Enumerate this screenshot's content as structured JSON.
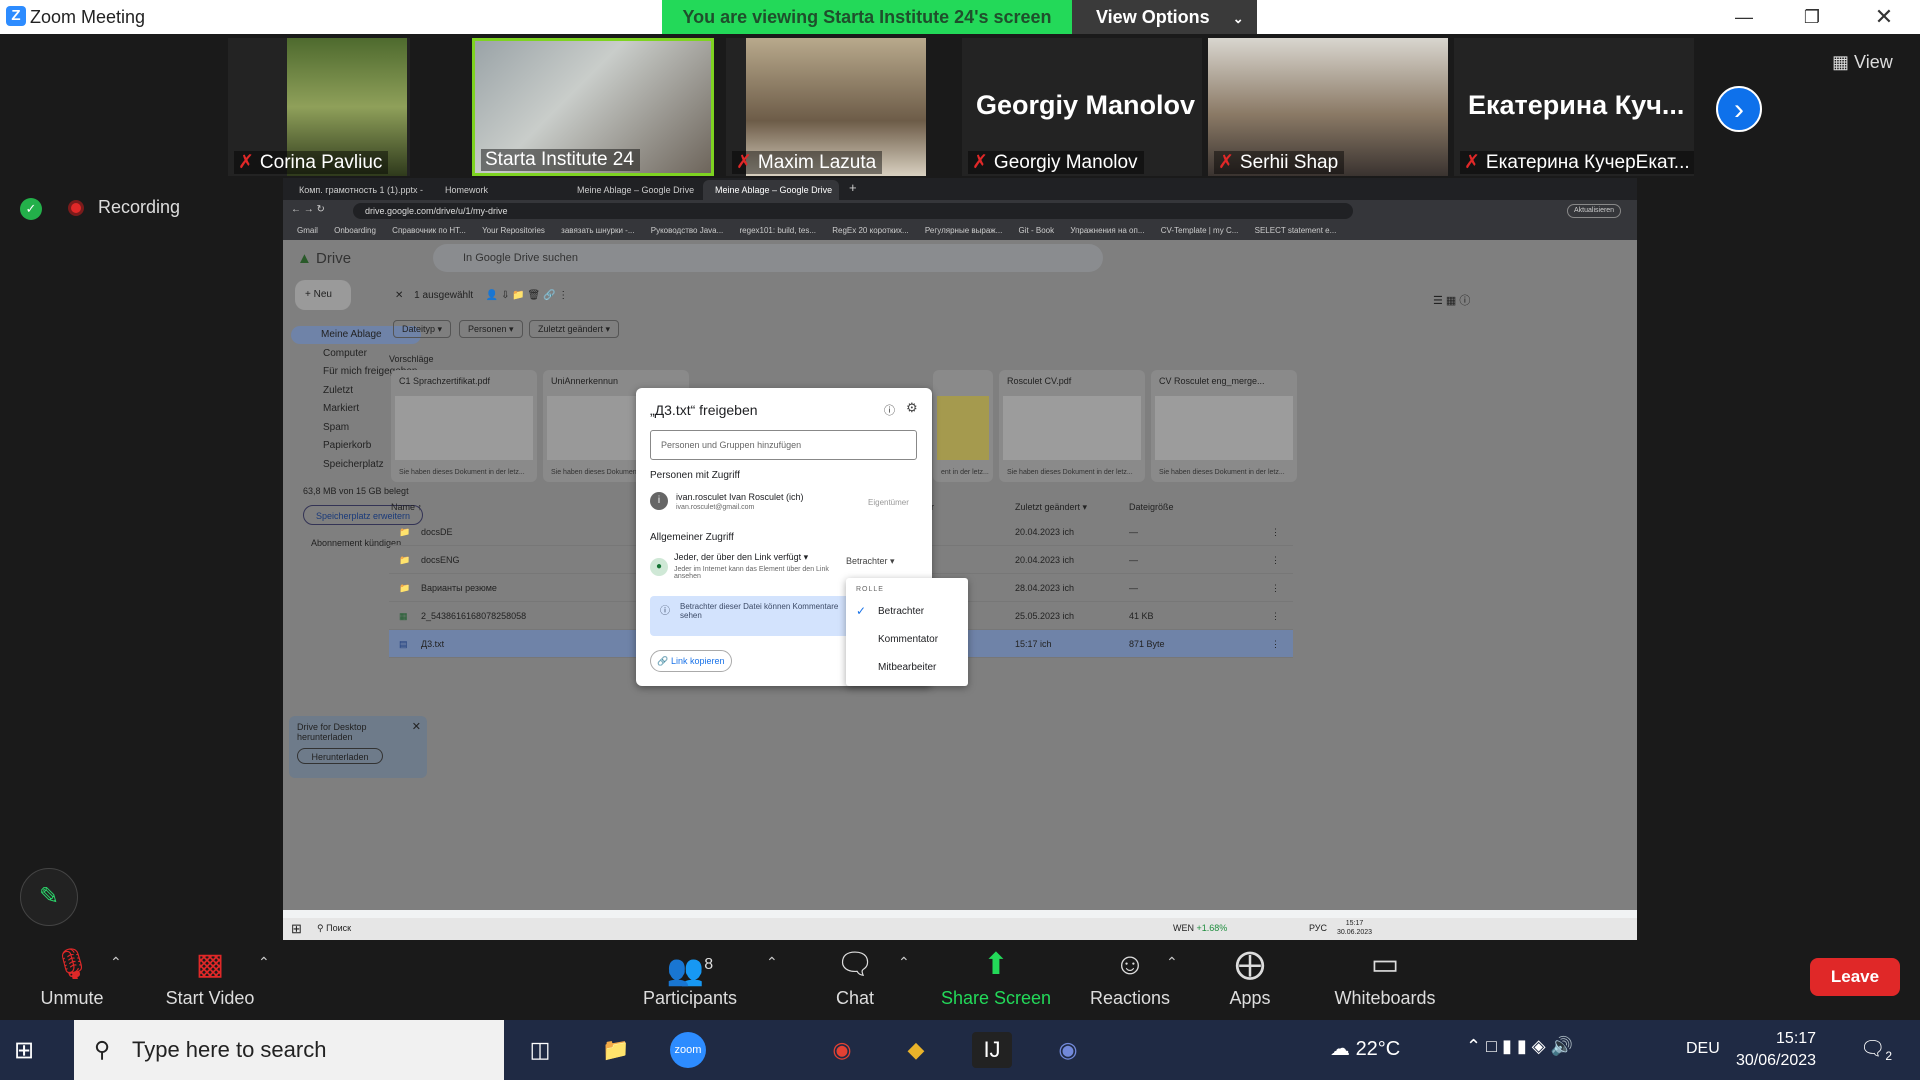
{
  "window": {
    "title": "Zoom Meeting",
    "viewing_banner": "You are viewing Starta Institute 24's screen",
    "view_options": "View Options",
    "view_button": "View"
  },
  "participants": [
    {
      "name": "Corina Pavliuc",
      "muted": true
    },
    {
      "name": "Starta Institute 24",
      "muted": false,
      "active": true
    },
    {
      "name": "Maxim Lazuta",
      "muted": true
    },
    {
      "name": "Georgiy Manolov",
      "muted": true,
      "big": "Georgiy Manolov"
    },
    {
      "name": "Serhii Shap",
      "muted": true
    },
    {
      "name": "Екатерина КучерЕкат...",
      "muted": true,
      "big": "Екатерина  Куч..."
    }
  ],
  "recording": "Recording",
  "browser": {
    "tabs": [
      "Комп. грамотность 1 (1).pptx - ",
      "Homework",
      "Meine Ablage – Google Drive",
      "Meine Ablage – Google Drive"
    ],
    "url": "drive.google.com/drive/u/1/my-drive",
    "update_label": "Aktualisieren",
    "bookmarks": [
      "Gmail",
      "Onboarding",
      "Справочник по HT...",
      "Your Repositories",
      "завязать шнурки -...",
      "Руководство Java...",
      "regex101: build, tes...",
      "RegEx 20 коротких...",
      "Регулярные выраж...",
      "Git - Book",
      "Упражнения на оп...",
      "CV-Template | my C...",
      "SELECT statement e..."
    ]
  },
  "drive": {
    "logo": "Drive",
    "search_placeholder": "In Google Drive suchen",
    "new_button": "Neu",
    "sidebar": [
      "Meine Ablage",
      "Computer",
      "Für mich freigegeben",
      "Zuletzt",
      "Markiert",
      "Spam",
      "Papierkorb",
      "Speicherplatz"
    ],
    "storage": "63,8 MB von 15 GB belegt",
    "storage_button": "Speicherplatz erweitern",
    "cancel_sub": "Abonnement kündigen",
    "selected": "1 ausgewählt",
    "filters": [
      "Dateityp",
      "Personen",
      "Zuletzt geändert"
    ],
    "suggestions_label": "Vorschläge",
    "cards": [
      {
        "title": "C1 Sprachzertifikat.pdf",
        "foot": "Sie haben dieses Dokument in der letz..."
      },
      {
        "title": "UniAnnerkennun",
        "foot": "Sie haben dieses Dokumen"
      },
      {
        "title": "",
        "foot": "ent in der letz..."
      },
      {
        "title": "Rosculet CV.pdf",
        "foot": "Sie haben dieses Dokument in der letz..."
      },
      {
        "title": "CV Rosculet eng_merge...",
        "foot": "Sie haben dieses Dokument in der letz..."
      }
    ],
    "headers": {
      "name": "Name",
      "r": "r",
      "modified": "Zuletzt geändert",
      "size": "Dateigröße"
    },
    "rows": [
      {
        "name": "docsDE",
        "modified": "20.04.2023 ich",
        "size": "—"
      },
      {
        "name": "docsENG",
        "modified": "20.04.2023 ich",
        "size": "—"
      },
      {
        "name": "Варианты резюме",
        "modified": "28.04.2023 ich",
        "size": "—"
      },
      {
        "name": "2_5438616168078258058",
        "modified": "25.05.2023 ich",
        "size": "41 KB"
      },
      {
        "name": "Д3.txt",
        "modified": "15:17 ich",
        "size": "871 Byte"
      }
    ],
    "download_box": {
      "text": "Drive for Desktop herunterladen",
      "button": "Herunterladen"
    }
  },
  "dialog": {
    "title": "„Д3.txt“ freigeben",
    "input_placeholder": "Personen und Gruppen hinzufügen",
    "access_label": "Personen mit Zugriff",
    "owner_name": "ivan.rosculet Ivan Rosculet (ich)",
    "owner_email": "ivan.rosculet@gmail.com",
    "owner_role": "Eigentümer",
    "general_label": "Allgemeiner Zugriff",
    "link_access": "Jeder, der über den Link verfügt",
    "link_desc": "Jeder im Internet kann das Element über den Link ansehen",
    "role_selected": "Betrachter",
    "info": "Betrachter dieser Datei können Kommentare sehen",
    "copy_link": "Link kopieren",
    "role_menu": {
      "header": "ROLLE",
      "items": [
        "Betrachter",
        "Kommentator",
        "Mitbearbeiter"
      ]
    }
  },
  "inner_taskbar": {
    "search": "Поиск",
    "ticker": "WEN",
    "ticker_change": "+1.68%",
    "lang": "РУС",
    "time": "15:17",
    "date": "30.06.2023"
  },
  "controls": [
    {
      "label": "Unmute",
      "icon": "mic-off-icon"
    },
    {
      "label": "Start Video",
      "icon": "video-off-icon"
    },
    {
      "label": "Participants",
      "icon": "participants-icon",
      "count": "8"
    },
    {
      "label": "Chat",
      "icon": "chat-icon"
    },
    {
      "label": "Share Screen",
      "icon": "share-screen-icon"
    },
    {
      "label": "Reactions",
      "icon": "reactions-icon"
    },
    {
      "label": "Apps",
      "icon": "apps-icon"
    },
    {
      "label": "Whiteboards",
      "icon": "whiteboard-icon"
    }
  ],
  "leave": "Leave",
  "taskbar": {
    "search": "Type here to search",
    "temp": "22°C",
    "lang": "DEU",
    "time": "15:17",
    "date": "30/06/2023",
    "notifications": "2"
  },
  "colors": {
    "zoom_blue": "#2d8cff",
    "share_green": "#23d959",
    "leave_red": "#e02828"
  }
}
